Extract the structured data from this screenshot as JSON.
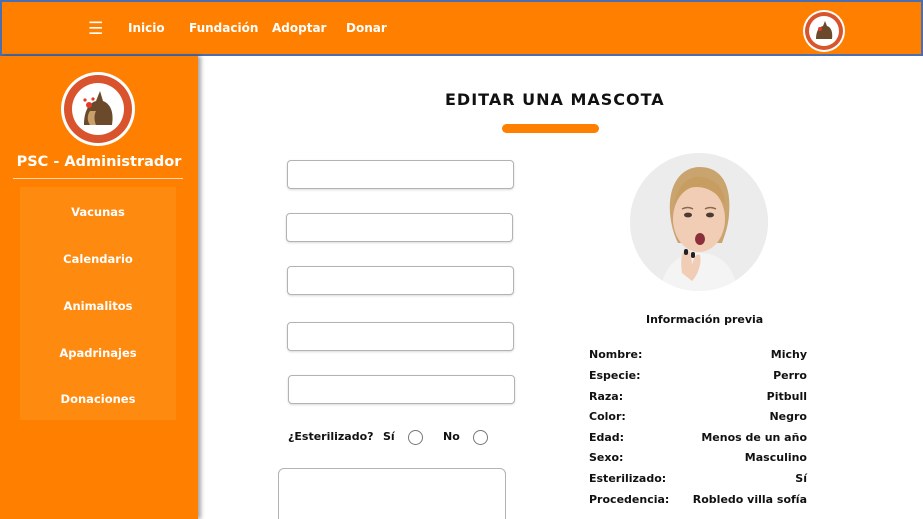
{
  "header": {
    "menu_icon": "☰",
    "nav": {
      "inicio": "Inicio",
      "fundacion": "Fundación",
      "adoptar": "Adoptar",
      "donar": "Donar"
    }
  },
  "sidebar": {
    "title": "PSC - Administrador",
    "items": [
      "Vacunas",
      "Calendario",
      "Animalitos",
      "Apadrinajes",
      "Donaciones"
    ]
  },
  "main": {
    "title": "EDITAR UNA MASCOTA",
    "sterilized_question": "¿Esterilizado?",
    "option_yes": "Sí",
    "option_no": "No"
  },
  "info": {
    "title": "Información previa",
    "rows": [
      {
        "label": "Nombre:",
        "value": "Michy"
      },
      {
        "label": "Especie:",
        "value": "Perro"
      },
      {
        "label": "Raza:",
        "value": "Pitbull"
      },
      {
        "label": "Color:",
        "value": "Negro"
      },
      {
        "label": "Edad:",
        "value": "Menos de un año"
      },
      {
        "label": "Sexo:",
        "value": "Masculino"
      },
      {
        "label": "Esterilizado:",
        "value": "Sí"
      },
      {
        "label": "Procedencia:",
        "value": "Robledo villa sofía"
      }
    ]
  },
  "colors": {
    "brand_orange": "#ff8000",
    "header_border": "#4a6fb0"
  }
}
